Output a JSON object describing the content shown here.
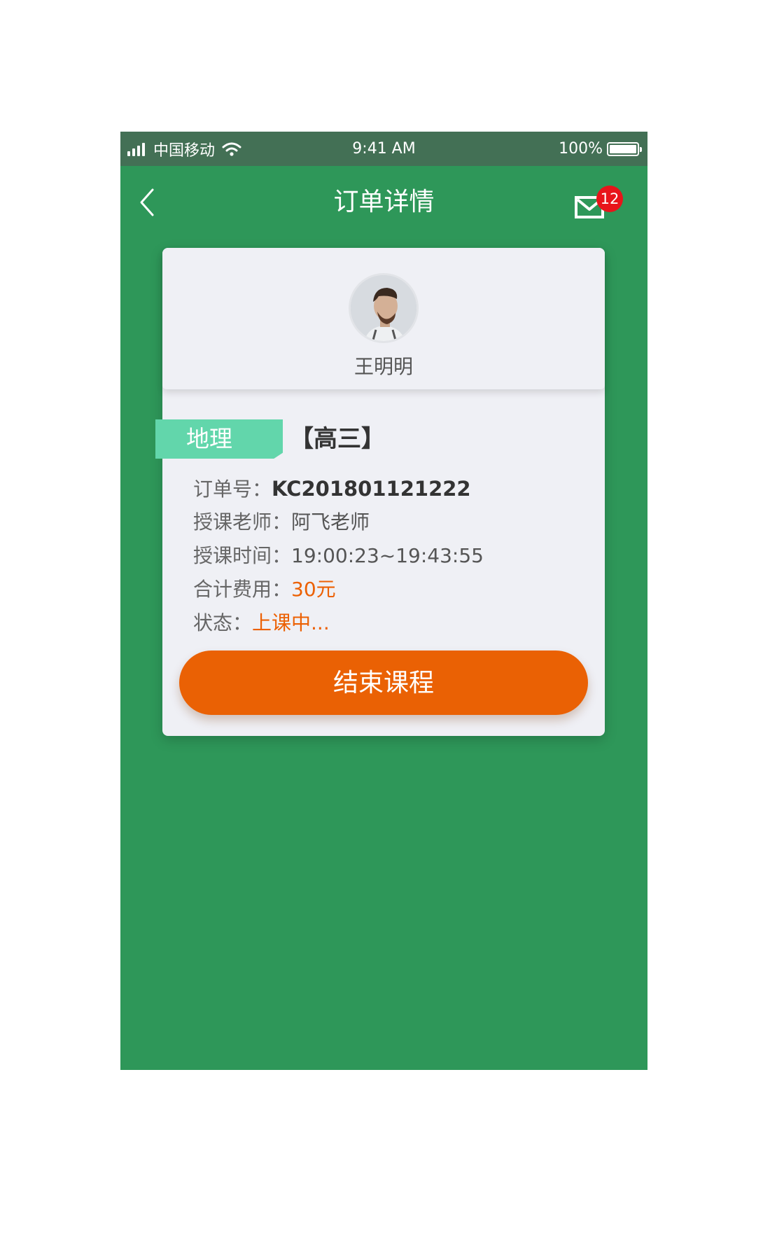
{
  "status_bar": {
    "carrier": "中国移动",
    "time": "9:41 AM",
    "battery": "100%",
    "battery_level": 1.0,
    "icons": [
      "signal-bars-icon",
      "wifi-icon",
      "battery-icon"
    ]
  },
  "nav": {
    "title": "订单详情",
    "back_icon": "chevron-left-icon",
    "mail_icon": "mail-icon",
    "mail_badge": "12"
  },
  "profile": {
    "name": "王明明",
    "avatar_icon": "user-avatar"
  },
  "course": {
    "subject": "地理",
    "grade": "【高三】"
  },
  "details": {
    "order_label": "订单号：",
    "order_value": "KC201801121222",
    "teacher_label": "授课老师：",
    "teacher_value": "阿飞老师",
    "time_label": "授课时间：",
    "time_value": "19:00:23~19:43:55",
    "fee_label": "合计费用：",
    "fee_value": "30元",
    "status_label": "状态：",
    "status_value": "上课中..."
  },
  "actions": {
    "end_course": "结束课程"
  },
  "colors": {
    "background": "#2e9759",
    "status_bar": "#437055",
    "accent_orange": "#ea6104",
    "tag_green": "#62d6ab",
    "badge_red": "#e8141a",
    "card": "#eff0f5"
  }
}
